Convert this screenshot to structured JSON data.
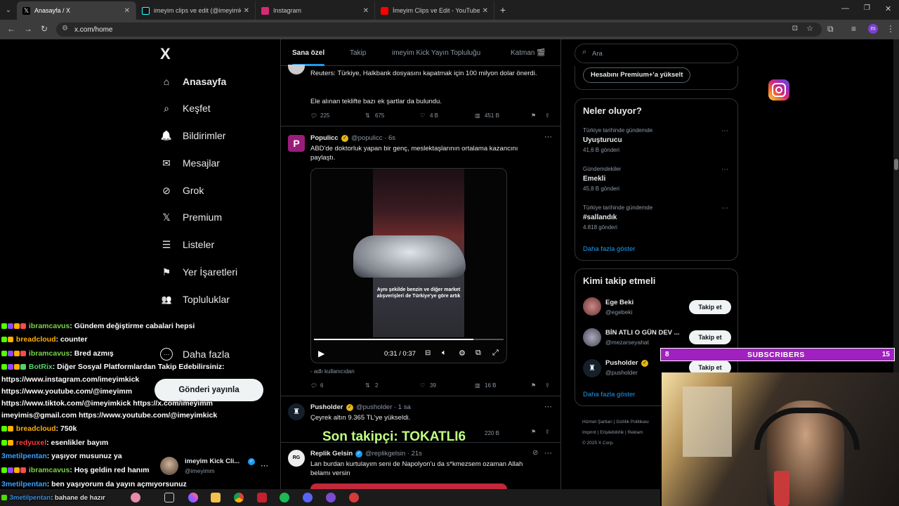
{
  "browser": {
    "tabs": [
      {
        "title": "Anasayfa / X",
        "fav_color": "#000000"
      },
      {
        "title": "imeyim clips ve edit (@imeyimk",
        "fav_color": "#000000"
      },
      {
        "title": "Instagram",
        "fav_color": "#d62976"
      },
      {
        "title": "İmeyim Clips ve Edit - YouTube",
        "fav_color": "#ff0000"
      }
    ],
    "url": "x.com/home",
    "profile_initial": "m"
  },
  "x_nav": {
    "logo": "X",
    "items": [
      {
        "label": "Anasayfa",
        "icon": "home-icon",
        "glyph": "⌂"
      },
      {
        "label": "Keşfet",
        "icon": "search-icon",
        "glyph": "⌕"
      },
      {
        "label": "Bildirimler",
        "icon": "bell-icon",
        "glyph": "🔔"
      },
      {
        "label": "Mesajlar",
        "icon": "mail-icon",
        "glyph": "✉"
      },
      {
        "label": "Grok",
        "icon": "grok-icon",
        "glyph": "⊘"
      },
      {
        "label": "Premium",
        "icon": "x-premium-icon",
        "glyph": "𝕏"
      },
      {
        "label": "Listeler",
        "icon": "list-icon",
        "glyph": "☰"
      },
      {
        "label": "Yer İşaretleri",
        "icon": "bookmark-icon",
        "glyph": "⚑"
      },
      {
        "label": "Topluluklar",
        "icon": "communities-icon",
        "glyph": "👥"
      },
      {
        "label": "Daha fazla",
        "icon": "more-circle-icon",
        "glyph": "⋯"
      }
    ],
    "post_button": "Gönderi yayınla",
    "account_name": "imeyim Kick Cli...",
    "account_handle": "@imeyimm"
  },
  "feed": {
    "tabs": [
      "Sana özel",
      "Takip",
      "imeyim Kick Yayın Topluluğu",
      "Katman 🎬"
    ],
    "post1": {
      "line1": "Reuters: Türkiye, Halkbank dosyasını kapatmak için 100 milyon dolar önerdi.",
      "line2": "Ele alınan teklifte bazı ek şartlar da bulundu.",
      "replies": "225",
      "reposts": "675",
      "likes": "4 B",
      "views": "451 B"
    },
    "post2": {
      "name": "Populicc",
      "handle": "@populicc · 6s",
      "text": "ABD'de doktorluk yapan bir genç, meslektaşlarının ortalama kazancını paylaştı.",
      "video_caption": "Aynı şekilde benzin ve diğer market alışverişleri de Türkiye'ye göre artık",
      "time": "0:31 / 0:37",
      "progress": 0.84,
      "source": "- adlı kullanıcıdan",
      "replies": "6",
      "reposts": "2",
      "likes": "39",
      "views": "16 B"
    },
    "post3": {
      "name": "Pusholder",
      "handle": "@pusholder · 1 sa",
      "text": "Çeyrek altın 9.365 TL'ye yükseldi.",
      "views": "220 B"
    },
    "post4": {
      "name": "Replik Gelsin",
      "handle": "@replikgelsin · 21s",
      "text": "Lan burdan kurtulayım seni de Napolyon'u da s*kmezsem ozaman Allah belamı versin"
    }
  },
  "right": {
    "search_placeholder": "Ara",
    "premium_button": "Hesabını Premium+'a yükselt",
    "trends_title": "Neler oluyor?",
    "trends": [
      {
        "meta": "Türkiye tarihinde gündemde",
        "name": "Uyuşturucu",
        "count": "41,6 B gönderi"
      },
      {
        "meta": "Gündemdekiler",
        "name": "Emekli",
        "count": "45,8 B gönderi"
      },
      {
        "meta": "Türkiye tarihinde gündemde",
        "name": "#sallandık",
        "count": "4.818 gönderi"
      }
    ],
    "trends_more": "Daha fazla göster",
    "who_title": "Kimi takip etmeli",
    "who": [
      {
        "name": "Ege Beki",
        "handle": "@egebeki",
        "button": "Takip et"
      },
      {
        "name": "BİN ATLI O GÜN DEV ...",
        "handle": "@mezarseyahat",
        "button": "Takip et"
      },
      {
        "name": "Pusholder",
        "handle": "@pusholder",
        "button": "Takip et"
      }
    ],
    "who_more": "Daha fazla göster",
    "footer": [
      "Hizmet Şartları",
      "Gizlilik Politikası",
      "Imprint",
      "Erişilebilirlik",
      "Reklam",
      "© 2025 X Corp."
    ]
  },
  "stream": {
    "sub_left": "8",
    "sub_label": "SUBSCRIBERS",
    "sub_right": "15",
    "last_follower": "Son takipçi: TOKATLI6",
    "chat": [
      {
        "user": "ibramcavus",
        "color": "#7bd34c",
        "msg": ": Gündem değiştirme cabalari hepsi"
      },
      {
        "user": "breadcloud",
        "color": "#ffb000",
        "msg": ": counter"
      },
      {
        "user": "ibramcavus",
        "color": "#7bd34c",
        "msg": ": Bred azmış"
      },
      {
        "user": "BotRix",
        "color": "#55d36b",
        "msg": ": Diğer Sosyal Platformlardan Takip Edebilirsiniz:"
      },
      {
        "user": "",
        "color": "#ffffff",
        "msg": "https://www.instagram.com/imeyimkick"
      },
      {
        "user": "",
        "color": "#ffffff",
        "msg": "https://www.youtube.com/@imeyimm"
      },
      {
        "user": "",
        "color": "#ffffff",
        "msg": "https://www.tiktok.com/@imeyimkick https://x.com/imeyimm"
      },
      {
        "user": "",
        "color": "#ffffff",
        "msg": "imeyimis@gmail.com https://www.youtube.com/@imeyimkick"
      },
      {
        "user": "breadcloud",
        "color": "#ffb000",
        "msg": ": 750k"
      },
      {
        "user": "redyuxel",
        "color": "#ff3b3b",
        "msg": ": esenlikler bayım"
      },
      {
        "user": "3metilpentan",
        "color": "#3aa0ff",
        "msg": ": yaşıyor musunuz ya"
      },
      {
        "user": "ibramcavus",
        "color": "#7bd34c",
        "msg": ": Hoş geldin red hanım"
      },
      {
        "user": "3metilpentan",
        "color": "#3aa0ff",
        "msg": ": ben yaşıyorum da yayın açmıyorsunuz"
      },
      {
        "user": "3metilpentan",
        "color": "#3aa0ff",
        "msg": ": bahane de hazır"
      }
    ]
  }
}
